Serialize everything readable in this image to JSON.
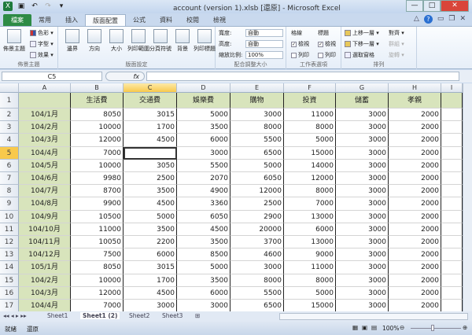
{
  "window": {
    "title": "account (version 1).xlsb [還原] - Microsoft Excel",
    "min": "—",
    "max": "□",
    "close": "✕"
  },
  "tabs": [
    "檔案",
    "常用",
    "插入",
    "版面配置",
    "公式",
    "資料",
    "校閱",
    "檢視"
  ],
  "ribbon": {
    "themes": {
      "label": "佈景主題",
      "big": "佈景主題",
      "colors": "色彩 ▾",
      "fonts": "字型 ▾",
      "effects": "效果 ▾"
    },
    "page_setup": {
      "label": "版面設定",
      "buttons": [
        "邊界",
        "方向",
        "大小",
        "列印範圍",
        "分頁符號",
        "背景",
        "列印標題"
      ]
    },
    "scale": {
      "label": "配合調整大小",
      "width_label": "寬度:",
      "width_value": "自動",
      "height_label": "高度:",
      "height_value": "自動",
      "scale_label": "縮放比例:",
      "scale_value": "100%"
    },
    "sheet_options": {
      "label": "工作表選項",
      "gridlines": "格線",
      "headings": "標題",
      "view": "檢視",
      "print": "列印"
    },
    "arrange": {
      "label": "排列",
      "bring_forward": "上移一層 ▾",
      "send_backward": "下移一層 ▾",
      "selection_pane": "選取窗格",
      "align": "對齊 ▾",
      "group": "群組 ▾",
      "rotate": "旋轉 ▾"
    }
  },
  "formula_bar": {
    "name_box": "C5",
    "fx": "fx",
    "value": ""
  },
  "columns": [
    "A",
    "B",
    "C",
    "D",
    "E",
    "F",
    "G",
    "H",
    "I"
  ],
  "header_row": [
    "",
    "生活費",
    "交通費",
    "娛樂費",
    "購物",
    "投資",
    "儲蓄",
    "孝親"
  ],
  "rows": [
    [
      "104/1月",
      "8050",
      "3015",
      "5000",
      "3000",
      "11000",
      "3000",
      "2000"
    ],
    [
      "104/2月",
      "10000",
      "1700",
      "3500",
      "8000",
      "8000",
      "3000",
      "2000"
    ],
    [
      "104/3月",
      "12000",
      "4500",
      "6000",
      "5500",
      "5000",
      "3000",
      "2000"
    ],
    [
      "104/4月",
      "7000",
      "",
      "3000",
      "6500",
      "15000",
      "3000",
      "2000"
    ],
    [
      "104/5月",
      "10000",
      "3050",
      "5500",
      "5000",
      "14000",
      "3000",
      "2000"
    ],
    [
      "104/6月",
      "9980",
      "2500",
      "2070",
      "6050",
      "12000",
      "3000",
      "2000"
    ],
    [
      "104/7月",
      "8700",
      "3500",
      "4900",
      "12000",
      "8000",
      "3000",
      "2000"
    ],
    [
      "104/8月",
      "9900",
      "4500",
      "3360",
      "2500",
      "7000",
      "3000",
      "2000"
    ],
    [
      "104/9月",
      "10500",
      "5000",
      "6050",
      "2900",
      "13000",
      "3000",
      "2000"
    ],
    [
      "104/10月",
      "11000",
      "3500",
      "4500",
      "20000",
      "6000",
      "3000",
      "2000"
    ],
    [
      "104/11月",
      "10050",
      "2200",
      "3500",
      "3700",
      "13000",
      "3000",
      "2000"
    ],
    [
      "104/12月",
      "7500",
      "6000",
      "8500",
      "4600",
      "9000",
      "3000",
      "2000"
    ],
    [
      "105/1月",
      "8050",
      "3015",
      "5000",
      "3000",
      "11000",
      "3000",
      "2000"
    ],
    [
      "104/2月",
      "10000",
      "1700",
      "3500",
      "8000",
      "8000",
      "3000",
      "2000"
    ],
    [
      "104/3月",
      "12000",
      "4500",
      "6000",
      "5500",
      "5000",
      "3000",
      "2000"
    ],
    [
      "104/4月",
      "7000",
      "3000",
      "3000",
      "6500",
      "15000",
      "3000",
      "2000"
    ]
  ],
  "sheets": [
    "Sheet1",
    "Sheet1 (2)",
    "Sheet2",
    "Sheet3"
  ],
  "status": {
    "ready": "就緒",
    "restore": "還原",
    "zoom": "100%"
  }
}
